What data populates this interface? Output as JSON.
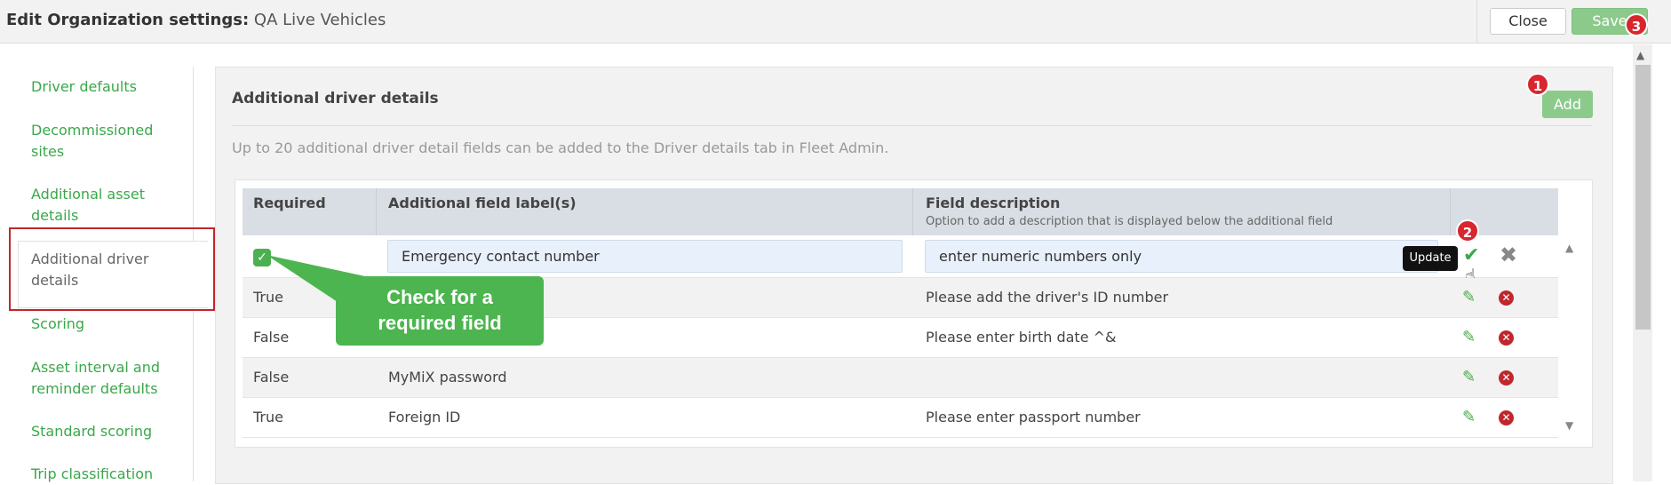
{
  "header": {
    "title_label": "Edit Organization settings:",
    "title_name": "QA Live Vehicles",
    "close_label": "Close",
    "save_label": "Save"
  },
  "badges": {
    "one": "1",
    "two": "2",
    "three": "3"
  },
  "sidebar": {
    "items": [
      {
        "label": "Driver defaults"
      },
      {
        "label": "Decommissioned sites"
      },
      {
        "label": "Additional asset details"
      },
      {
        "label": "Additional driver details"
      },
      {
        "label": "Scoring"
      },
      {
        "label": "Asset interval and reminder defaults"
      },
      {
        "label": "Standard scoring"
      },
      {
        "label": "Trip classification"
      }
    ]
  },
  "section": {
    "title": "Additional driver details",
    "add_label": "Add",
    "info": "Up to 20 additional driver detail fields can be added to the Driver details tab in Fleet Admin."
  },
  "table": {
    "headers": {
      "required": "Required",
      "label": "Additional field label(s)",
      "description": "Field description",
      "description_sub": "Option to add a description that is displayed below the additional field"
    },
    "edit_row": {
      "required_checked": true,
      "label_value": "Emergency contact number",
      "description_value": "enter numeric numbers only"
    },
    "rows": [
      {
        "required": "True",
        "label": "",
        "description": "Please add the driver's ID number"
      },
      {
        "required": "False",
        "label": "",
        "description": "Please enter birth date ^&"
      },
      {
        "required": "False",
        "label": "MyMiX password",
        "description": ""
      },
      {
        "required": "True",
        "label": "Foreign ID",
        "description": "Please enter passport number"
      }
    ],
    "tooltip": "Update"
  },
  "callout": {
    "line1": "Check for a",
    "line2": "required field"
  },
  "colors": {
    "accent_green": "#3aa84a",
    "button_green": "#8cca8c",
    "badge_red": "#d8262f",
    "highlight_red": "#c0272d",
    "callout_green": "#4cb54f"
  }
}
